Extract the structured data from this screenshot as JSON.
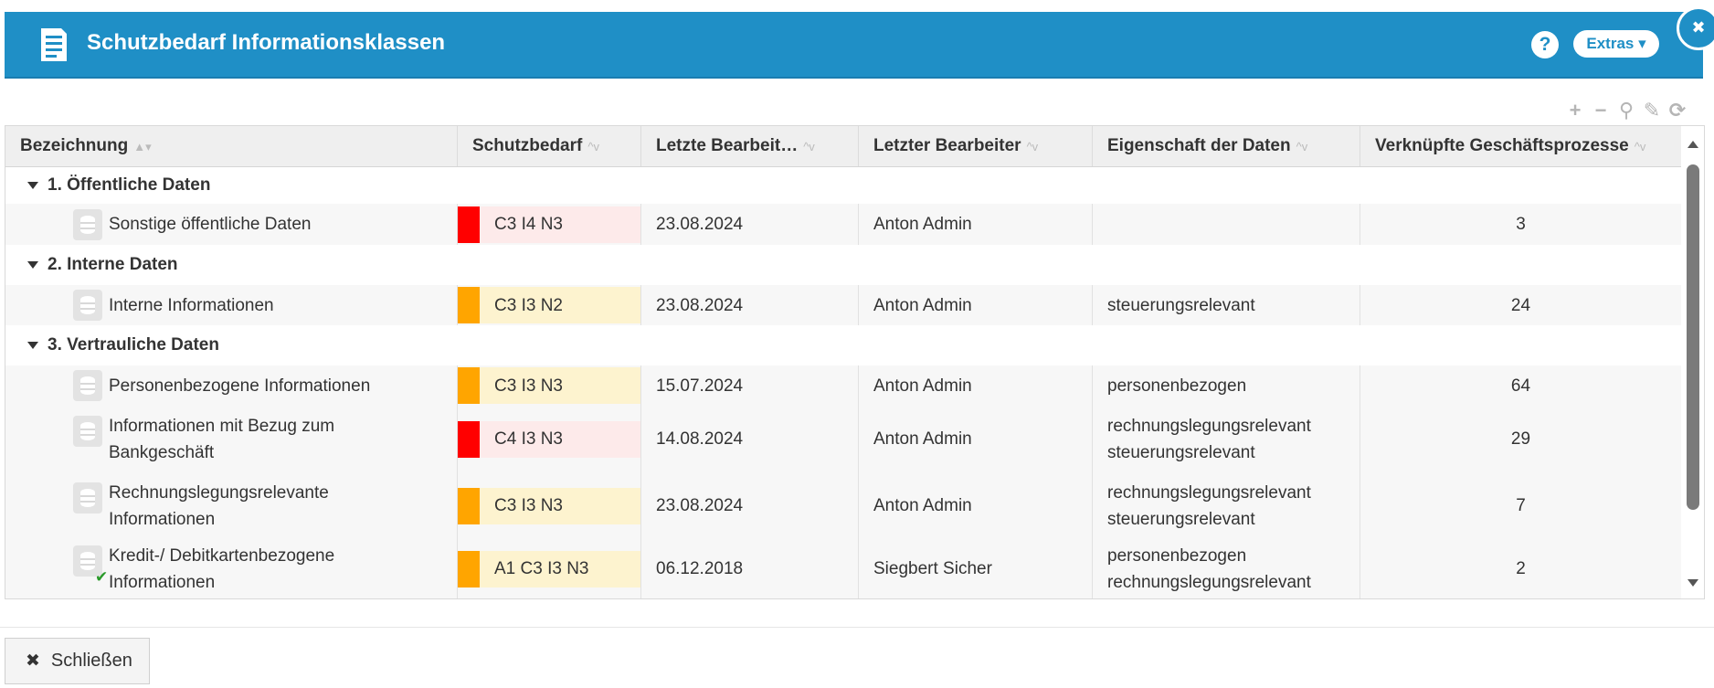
{
  "window": {
    "title": "Schutzbedarf Informationsklassen",
    "help_label": "?",
    "extras_label": "Extras ▾",
    "close_glyph": "✖"
  },
  "toolbar": {
    "add_icon": "+",
    "remove_icon": "−",
    "search_icon": "⚲",
    "settings_icon": "✎",
    "refresh_icon": "⟳"
  },
  "colors": {
    "header_bg": "#1f8fc6",
    "red": "#ff0000",
    "orange": "#ffa500",
    "red_bg": "#fdeaea",
    "orange_bg": "#fdf3cf"
  },
  "columns": [
    {
      "label": "Bezeichnung",
      "sort": "▲▾"
    },
    {
      "label": "Schutzbedarf",
      "sort": "^v"
    },
    {
      "label": "Letzte Bearbeit…",
      "sort": "^v"
    },
    {
      "label": "Letzter Bearbeiter",
      "sort": "^v"
    },
    {
      "label": "Eigenschaft der Daten",
      "sort": "^v"
    },
    {
      "label": "Verknüpfte Geschäftsprozesse",
      "sort": "^v"
    }
  ],
  "groups": [
    {
      "label": "1. Öffentliche Daten"
    },
    {
      "label": "2. Interne Daten"
    },
    {
      "label": "3. Vertrauliche Daten"
    }
  ],
  "rows": [
    {
      "name1": "Sonstige öffentliche Daten",
      "name2": "",
      "schutz": "C3 I4 N3",
      "level": "red",
      "date": "23.08.2024",
      "editor": "Anton Admin",
      "prop1": "",
      "prop2": "",
      "count": "3"
    },
    {
      "name1": "Interne Informationen",
      "name2": "",
      "schutz": "C3 I3 N2",
      "level": "orange",
      "date": "23.08.2024",
      "editor": "Anton Admin",
      "prop1": "steuerungsrelevant",
      "prop2": "",
      "count": "24"
    },
    {
      "name1": "Personenbezogene Informationen",
      "name2": "",
      "schutz": "C3 I3 N3",
      "level": "orange",
      "date": "15.07.2024",
      "editor": "Anton Admin",
      "prop1": "personenbezogen",
      "prop2": "",
      "count": "64"
    },
    {
      "name1": "Informationen mit Bezug zum",
      "name2": "Bankgeschäft",
      "schutz": "C4 I3 N3",
      "level": "red",
      "date": "14.08.2024",
      "editor": "Anton Admin",
      "prop1": "rechnungslegungsrelevant",
      "prop2": "steuerungsrelevant",
      "count": "29"
    },
    {
      "name1": "Rechnungslegungsrelevante",
      "name2": "Informationen",
      "schutz": "C3 I3 N3",
      "level": "orange",
      "date": "23.08.2024",
      "editor": "Anton Admin",
      "prop1": "rechnungslegungsrelevant",
      "prop2": "steuerungsrelevant",
      "count": "7"
    },
    {
      "name1": "Kredit-/ Debitkartenbezogene",
      "name2": "Informationen",
      "schutz": "A1 C3 I3 N3",
      "level": "orange",
      "date": "06.12.2018",
      "editor": "Siegbert Sicher",
      "prop1": "personenbezogen",
      "prop2": "rechnungslegungsrelevant",
      "count": "2"
    }
  ],
  "footer": {
    "close_label": "Schließen",
    "close_glyph": "✖"
  }
}
